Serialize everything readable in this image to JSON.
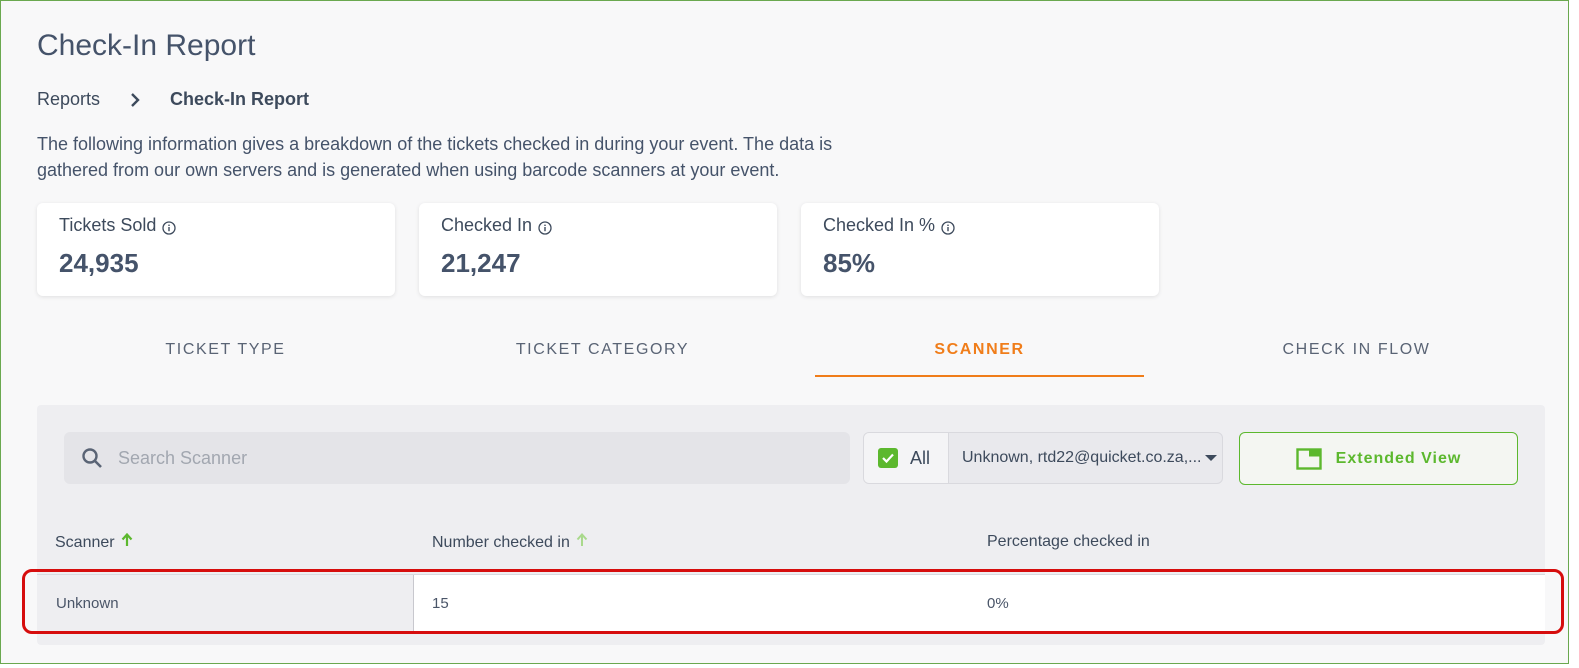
{
  "page": {
    "title": "Check-In Report",
    "breadcrumb": {
      "parent": "Reports",
      "current": "Check-In Report"
    },
    "description": "The following information gives a breakdown of the tickets checked in during your event. The data is gathered from our own servers and is generated when using barcode scanners at your event."
  },
  "stats": [
    {
      "label": "Tickets Sold",
      "value": "24,935",
      "icon": "info-icon"
    },
    {
      "label": "Checked In",
      "value": "21,247",
      "icon": "info-icon"
    },
    {
      "label": "Checked In %",
      "value": "85%",
      "icon": "info-icon"
    }
  ],
  "tabs": [
    {
      "label": "TICKET TYPE",
      "active": false
    },
    {
      "label": "TICKET CATEGORY",
      "active": false
    },
    {
      "label": "SCANNER",
      "active": true
    },
    {
      "label": "CHECK IN FLOW",
      "active": false
    }
  ],
  "toolbar": {
    "search_placeholder": "Search Scanner",
    "search_value": "",
    "filter_all_label": "All",
    "filter_all_checked": true,
    "filter_selected": "Unknown, rtd22@quicket.co.za,...",
    "extended_view_label": "Extended View"
  },
  "table": {
    "columns": [
      "Scanner",
      "Number checked in",
      "Percentage checked in"
    ],
    "rows": [
      {
        "scanner": "Unknown",
        "number": "15",
        "percentage": "0%"
      }
    ]
  },
  "colors": {
    "accent": "#f07d1a",
    "green": "#5cb82e",
    "highlight": "#d60d0d",
    "text": "#3d4a5c"
  }
}
